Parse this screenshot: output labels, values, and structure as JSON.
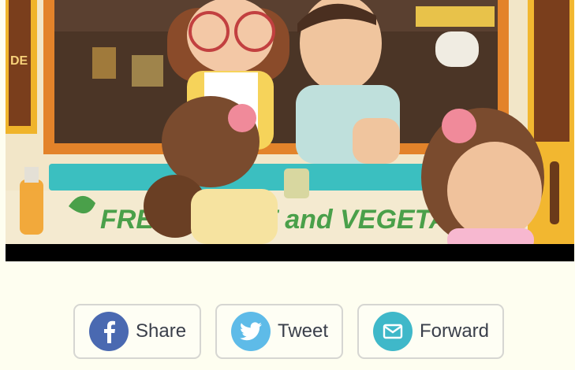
{
  "hero": {
    "banner_text": "FRESH FRUIT and VEGETABLES",
    "sign_fragment": "DE"
  },
  "share": {
    "buttons": [
      {
        "id": "share",
        "label": "Share",
        "icon": "facebook-icon",
        "color": "#4a69b1"
      },
      {
        "id": "tweet",
        "label": "Tweet",
        "icon": "twitter-bird-icon",
        "color": "#5ebbe8"
      },
      {
        "id": "forward",
        "label": "Forward",
        "icon": "envelope-icon",
        "color": "#3fb8c9"
      }
    ]
  }
}
